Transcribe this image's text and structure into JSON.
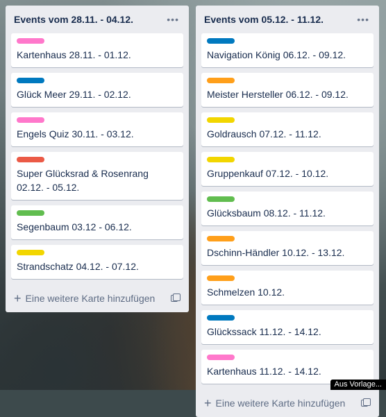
{
  "colors": {
    "pink": "#ff78cb",
    "blue": "#0079bf",
    "red": "#eb5a46",
    "green": "#61bd4f",
    "yellow": "#f2d600",
    "orange": "#ff9f1a"
  },
  "lists": [
    {
      "title": "Events vom 28.11. - 04.12.",
      "menu_icon": "more-icon",
      "add_label": "Eine weitere Karte hinzufügen",
      "cards": [
        {
          "title": "Kartenhaus 28.11. - 01.12.",
          "label_color": "#ff78cb"
        },
        {
          "title": "Glück Meer 29.11. - 02.12.",
          "label_color": "#0079bf"
        },
        {
          "title": "Engels Quiz 30.11. - 03.12.",
          "label_color": "#ff78cb"
        },
        {
          "title": "Super Glücksrad & Rosenrang 02.12. - 05.12.",
          "label_color": "#eb5a46"
        },
        {
          "title": "Segenbaum 03.12 - 06.12.",
          "label_color": "#61bd4f"
        },
        {
          "title": "Strandschatz 04.12. - 07.12.",
          "label_color": "#f2d600"
        }
      ]
    },
    {
      "title": "Events vom 05.12. - 11.12.",
      "menu_icon": "more-icon",
      "add_label": "Eine weitere Karte hinzufügen",
      "cards": [
        {
          "title": "Navigation König 06.12. - 09.12.",
          "label_color": "#0079bf"
        },
        {
          "title": "Meister Hersteller 06.12. - 09.12.",
          "label_color": "#ff9f1a"
        },
        {
          "title": "Goldrausch 07.12. - 11.12.",
          "label_color": "#f2d600"
        },
        {
          "title": "Gruppenkauf 07.12. - 10.12.",
          "label_color": "#f2d600"
        },
        {
          "title": "Glücksbaum 08.12. - 11.12.",
          "label_color": "#61bd4f"
        },
        {
          "title": "Dschinn-Händler 10.12. - 13.12.",
          "label_color": "#ff9f1a"
        },
        {
          "title": "Schmelzen 10.12.",
          "label_color": "#ff9f1a"
        },
        {
          "title": "Glückssack 11.12. - 14.12.",
          "label_color": "#0079bf"
        },
        {
          "title": "Kartenhaus 11.12. - 14.12.",
          "label_color": "#ff78cb"
        }
      ]
    }
  ],
  "photo_credit": "Aus Vorlage..."
}
